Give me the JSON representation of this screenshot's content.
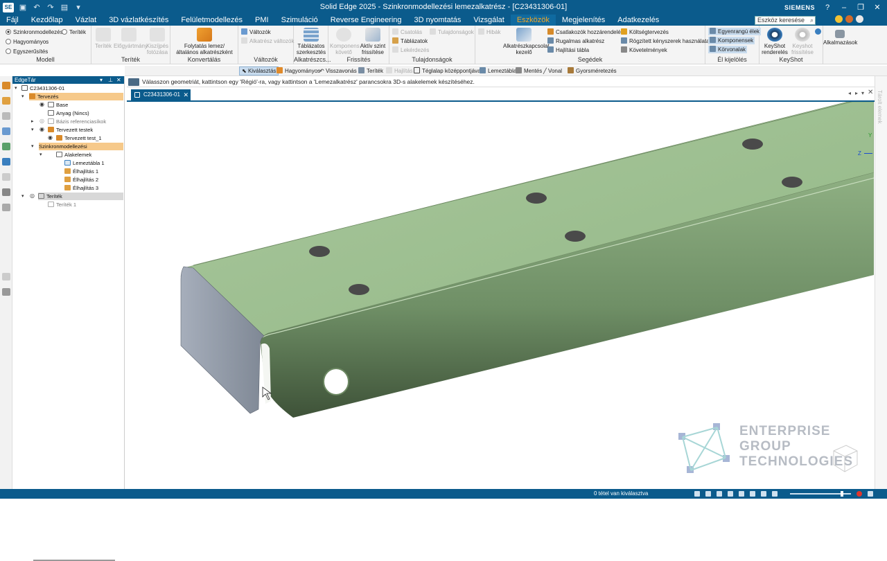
{
  "window": {
    "title": "Solid Edge 2025 - Szinkronmodellezési lemezalkatrész - [C23431306-01]",
    "brand": "SIEMENS",
    "app_badge": "SE"
  },
  "menu": [
    "Fájl",
    "Kezdőlap",
    "Vázlat",
    "3D vázlatkészítés",
    "Felületmodellezés",
    "PMI",
    "Szimuláció",
    "Reverse Engineering",
    "3D nyomtatás",
    "Vizsgálat",
    "Eszközök",
    "Megjelenítés",
    "Adatkezelés"
  ],
  "menu_active": "Eszközök",
  "search": {
    "placeholder": "Eszköz keresése"
  },
  "ribbon": {
    "modell": {
      "label": "Modell",
      "opt1": "Szinkronmodellezési",
      "opt2": "Hagyományos",
      "opt3": "Egyszerűsítés",
      "opt4": "Teríték"
    },
    "teritek": {
      "label": "Teríték",
      "b1": "Teríték",
      "b2": "Előgyártmány",
      "b3": "Kiszíjpés fotózása"
    },
    "konvertalas": {
      "label": "Konvertálás",
      "b1": "Folytatás lemez/\náltalános alkatrészként"
    },
    "valtozok": {
      "label": "Változók",
      "b1": "Változók",
      "b2": "Alkatrész változók"
    },
    "alkatreszcs": {
      "label": "Alkatrészcs...",
      "b1": "Táblázatos\nszerkesztés"
    },
    "frissites": {
      "label": "Frissítés",
      "b1": "Komponens\nkövető",
      "b2": "Aktív szint\nfrissítése"
    },
    "tulajdonsagok": {
      "label": "Tulajdonságok",
      "b1": "Csatolás",
      "b2": "Táblázatok",
      "b3": "Lekérdezés",
      "b4": "Tulajdonságok"
    },
    "segedek": {
      "label": "Segédek",
      "hibak": "Hibák",
      "kezelo": "Alkatrészkapcsolat\nkezelő",
      "c1": "Csatlakozók hozzárendelése",
      "c2": "Rugalmas alkatrész",
      "c3": "Hajlítási tábla",
      "c4": "Költségtervezés",
      "c5": "Rögzített kényszerek használata",
      "c6": "Követelmények"
    },
    "elkijelolés": {
      "label": "Él kijelölés",
      "e1": "Egyenrangú élek",
      "e2": "Komponensek",
      "e3": "Körvonalak"
    },
    "keyshot": {
      "label": "KeyShot",
      "k1": "KeyShot\nrenderelés",
      "k2": "Keyshot\nfrissítése"
    },
    "alkalmazasok": {
      "label": "Alkalmazások"
    }
  },
  "cmdbar": [
    "Kiválasztás",
    "Hagyományos",
    "Visszavonás",
    "Teríték",
    "Hajlítás",
    "Téglalap középpontjával",
    "Lemeztábla",
    "Mentés",
    "Vonal",
    "Gyorsméretezés"
  ],
  "prompt": "Válasszon geometriát, kattintson egy 'Régió'-ra, vagy kattintson a 'Lemezalkatrész' parancsokra 3D-s alakelemek készítéséhez.",
  "tree": {
    "title": "EdgeTár",
    "root": "C23431306-01",
    "n_tervezes": "Tervezés",
    "n_base": "Base",
    "n_anyag": "Anyag (Nincs)",
    "n_bazis": "Bázis referenciasíkok",
    "n_testek": "Tervezett testek",
    "n_test1": "Tervezett test_1",
    "n_szinkron": "Szinkronmodellezési",
    "n_alakelemek": "Alakelemek",
    "n_lemeztabla": "Lemeztábla 1",
    "n_elh1": "Élhajlítás 1",
    "n_elh2": "Élhajlítás 2",
    "n_elh3": "Élhajlítás 3",
    "n_teritek": "Teríték",
    "n_teritek1": "Teríték 1"
  },
  "doc_tab": "C23431306-01",
  "side_panel_label": "Tárolt elemek",
  "status": "0 tétel van kiválasztva",
  "watermark": {
    "l1": "ENTERPRISE",
    "l2": "GROUP",
    "l3": "TECHNOLOGIES"
  },
  "triad": {
    "y": "Y",
    "z": "Z"
  },
  "colors": {
    "title_blue": "#0b5b8c",
    "part_green": "#9dbf8f",
    "active_tab": "#f6a623",
    "highlight": "#f6c98a"
  }
}
